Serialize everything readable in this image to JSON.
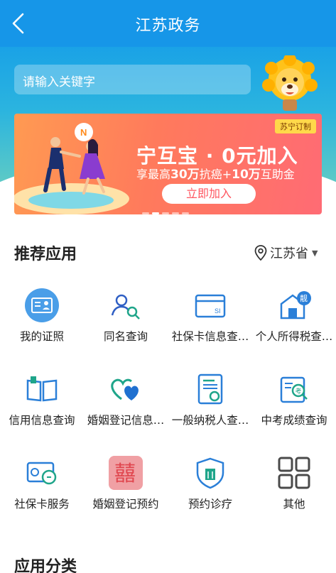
{
  "header": {
    "title": "江苏政务"
  },
  "search": {
    "placeholder": "请输入关键字"
  },
  "banner": {
    "tag": "苏宁订制",
    "title": "宁互宝 · 0元加入",
    "sub_prefix": "享最高",
    "sub_a": "30万",
    "sub_mid": "抗癌+",
    "sub_b": "10万",
    "sub_suffix": "互助金",
    "button": "立即加入"
  },
  "recommend": {
    "title": "推荐应用",
    "location": "江苏省",
    "apps": [
      {
        "label": "我的证照",
        "icon": "id-card-icon"
      },
      {
        "label": "同名查询",
        "icon": "person-search-icon"
      },
      {
        "label": "社保卡信息查…",
        "icon": "social-card-icon"
      },
      {
        "label": "个人所得税查…",
        "icon": "tax-house-icon"
      },
      {
        "label": "信用信息查询",
        "icon": "open-book-icon"
      },
      {
        "label": "婚姻登记信息…",
        "icon": "hearts-icon"
      },
      {
        "label": "一般纳税人查…",
        "icon": "certificate-icon"
      },
      {
        "label": "中考成绩查询",
        "icon": "exam-search-icon"
      },
      {
        "label": "社保卡服务",
        "icon": "card-service-icon"
      },
      {
        "label": "婚姻登记预约",
        "icon": "double-happiness-icon"
      },
      {
        "label": "预约诊疗",
        "icon": "hospital-shield-icon"
      },
      {
        "label": "其他",
        "icon": "grid-four-icon"
      }
    ]
  },
  "categories": {
    "title": "应用分类"
  },
  "colors": {
    "primary": "#1696e8",
    "banner_button_text": "#ff5660"
  }
}
